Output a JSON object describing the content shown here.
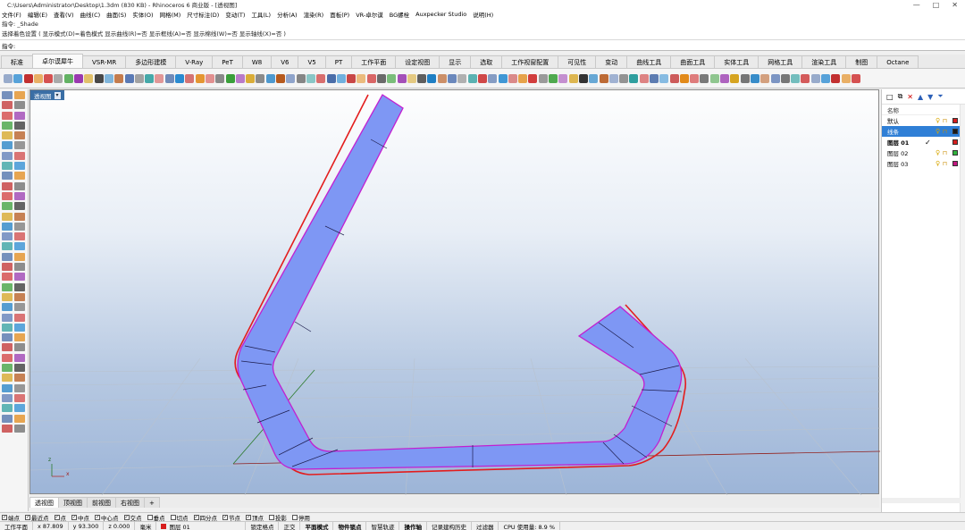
{
  "window": {
    "title": "C:\\Users\\Administrator\\Desktop\\1.3dm (830 KB) - Rhinoceros 6 商业版 - [透视图]",
    "minimize": "—",
    "maximize": "□",
    "close": "✕"
  },
  "menu": [
    "文件(F)",
    "编辑(E)",
    "查看(V)",
    "曲线(C)",
    "曲面(S)",
    "实体(O)",
    "网格(M)",
    "尺寸标注(D)",
    "变动(T)",
    "工具(L)",
    "分析(A)",
    "渲染(R)",
    "面板(P)",
    "VR-卓尔谟",
    "BG螺栓",
    "Auxpecker Studio",
    "说明(H)"
  ],
  "command": {
    "history_1": "指令: _Shade",
    "history_2": "选择着色设置 ( 显示模式(D)=着色模式  显示曲线(R)=否  显示框线(A)=否  显示棉线(W)=否  显示轴线(X)=否 )",
    "prompt": "指令:"
  },
  "tabs": [
    "标准",
    "卓尔谟犀牛",
    "VSR-MR",
    "多边形建模",
    "V-Ray",
    "PeT",
    "W8",
    "V6",
    "V5",
    "PT",
    "工作平面",
    "设定视图",
    "显示",
    "选取",
    "工作视窗配置",
    "可见性",
    "变动",
    "曲线工具",
    "曲面工具",
    "实体工具",
    "网格工具",
    "渲染工具",
    "制图",
    "Octane"
  ],
  "active_tab": "卓尔谟犀牛",
  "viewport": {
    "label": "透视图",
    "dropdown": "▾",
    "axis_x": "x",
    "axis_z": "z"
  },
  "viewport_tabs": [
    "透视图",
    "顶视图",
    "前视图",
    "右视图"
  ],
  "viewport_tab_add": "+",
  "layers": {
    "header": "名称",
    "rows": [
      {
        "name": "默认",
        "color": "#d71d1d",
        "current": false,
        "selected": false
      },
      {
        "name": "线条",
        "color": "#1a1a1a",
        "current": false,
        "selected": true
      },
      {
        "name": "图层 01",
        "color": "#d71d1d",
        "current": true,
        "selected": false
      },
      {
        "name": "图层 02",
        "color": "#2fb33c",
        "current": false,
        "selected": false
      },
      {
        "name": "图层 03",
        "color": "#c2187f",
        "current": false,
        "selected": false
      }
    ]
  },
  "osnaps": [
    {
      "label": "端点",
      "checked": true
    },
    {
      "label": "最近点",
      "checked": true
    },
    {
      "label": "点",
      "checked": true
    },
    {
      "label": "中点",
      "checked": true
    },
    {
      "label": "中心点",
      "checked": true
    },
    {
      "label": "交点",
      "checked": true
    },
    {
      "label": "垂点",
      "checked": false
    },
    {
      "label": "切点",
      "checked": false
    },
    {
      "label": "四分点",
      "checked": true
    },
    {
      "label": "节点",
      "checked": true
    },
    {
      "label": "顶点",
      "checked": true
    },
    {
      "label": "投影",
      "checked": false
    },
    {
      "label": "停用",
      "checked": false
    }
  ],
  "status": {
    "plane": "工作平面",
    "x": "x 87.809",
    "y": "y 93.300",
    "z": "z 0.000",
    "unit": "毫米",
    "layer": "图层 01",
    "items": [
      "锁定格点",
      "正交",
      "平面模式",
      "物件锁点",
      "智慧轨迹",
      "操作轴",
      "记录建构历史",
      "过滤器"
    ],
    "bold_items": [
      "平面模式",
      "物件锁点",
      "操作轴"
    ],
    "cpu": "CPU 使用量: 8.9 %"
  },
  "colors": {
    "surface": "#7e97f4",
    "outline": "#e31d1d",
    "edge": "#c21fd1",
    "grid": "#b8c2cf"
  }
}
